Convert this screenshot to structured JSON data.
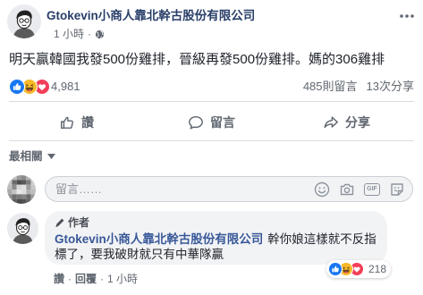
{
  "post": {
    "author_name": "Gtokevin小商人靠北幹古股份有限公司",
    "timestamp": "1 小時",
    "separator": "·",
    "privacy_icon": "globe-icon",
    "more_icon": "more-icon",
    "text": "明天贏韓國我發500份雞排，晉級再發500份雞排。媽的306雞排"
  },
  "reactions": {
    "icons": [
      "like-reaction-icon",
      "haha-reaction-icon",
      "love-reaction-icon"
    ],
    "count": "4,981",
    "comments_count": "485則留言",
    "shares_count": "13次分享"
  },
  "actions": [
    {
      "label": "讚",
      "icon": "thumbs-up-icon"
    },
    {
      "label": "留言",
      "icon": "comment-icon"
    },
    {
      "label": "分享",
      "icon": "share-icon"
    }
  ],
  "comments": {
    "sort_label": "最相關",
    "sort_icon": "caret-down-icon",
    "composer": {
      "placeholder": "留言……",
      "icons": [
        "emoji-icon",
        "camera-icon",
        "gif-icon",
        "sticker-icon"
      ],
      "gif_label": "GIF"
    },
    "items": [
      {
        "badge_icon": "author-pen-icon",
        "badge_label": "作者",
        "author_name": "Gtokevin小商人靠北幹古股份有限公司",
        "text": "幹你娘這樣就不反指標了，要我破財就只有中華隊贏",
        "reaction_icons": [
          "like-reaction-icon",
          "haha-reaction-icon",
          "love-reaction-icon"
        ],
        "reaction_count": "218",
        "like_label": "讚",
        "reply_label": "回覆",
        "timestamp": "1 小時",
        "separator": "·"
      }
    ]
  },
  "colors": {
    "link_blue": "#385898",
    "author_header": "#283e68",
    "text_primary": "#1d2129",
    "text_secondary": "#606770",
    "divider": "#dadde1",
    "bubble_bg": "#f2f3f5",
    "like_blue": "#1877f2",
    "haha_yellow": "#f7b928",
    "love_red": "#f33e58"
  }
}
